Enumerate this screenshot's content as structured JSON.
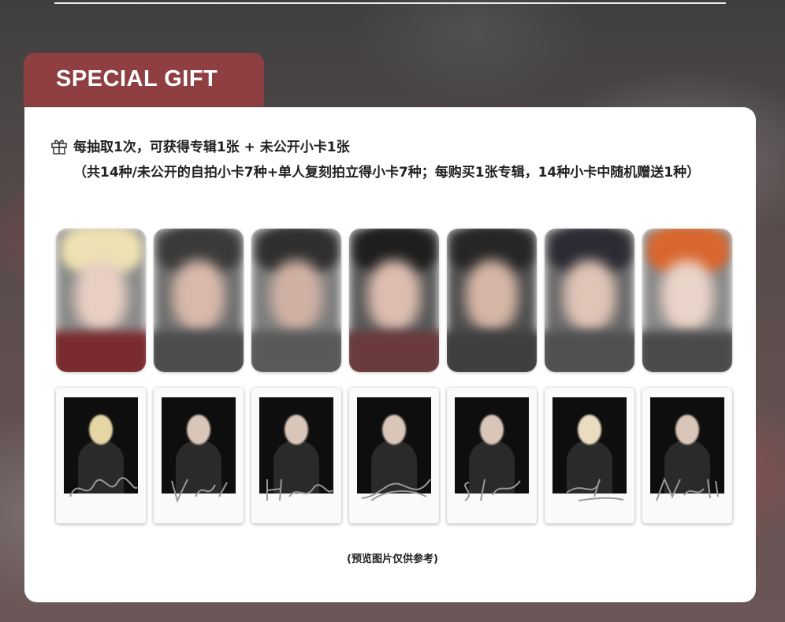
{
  "header": {
    "tab_label": "SPECIAL GIFT"
  },
  "gift": {
    "icon": "gift-icon",
    "line1": "每抽取1次，可获得专辑1张 + 未公开小卡1张",
    "line2": "（共14种/未公开的自拍小卡7种+单人复刻拍立得小卡7种；每购买1张专辑，14种小卡中随机赠送1种）"
  },
  "caption": "(预览图片仅供参考)",
  "colors": {
    "accent": "#8f3f42",
    "card": "#ffffff"
  }
}
